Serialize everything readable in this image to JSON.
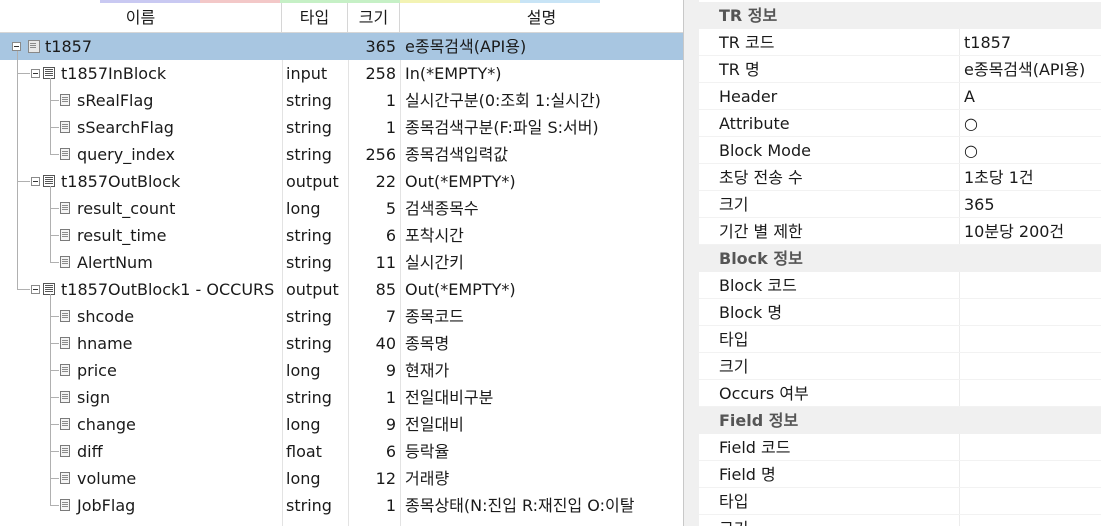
{
  "tree": {
    "columns": {
      "name": "이름",
      "type": "타입",
      "size": "크기",
      "desc": "설명"
    },
    "rows": [
      {
        "name": "t1857",
        "type": "",
        "size": "365",
        "desc": "e종목검색(API용)"
      },
      {
        "name": "t1857InBlock",
        "type": "input",
        "size": "258",
        "desc": "In(*EMPTY*)"
      },
      {
        "name": "sRealFlag",
        "type": "string",
        "size": "1",
        "desc": "실시간구분(0:조회 1:실시간)"
      },
      {
        "name": "sSearchFlag",
        "type": "string",
        "size": "1",
        "desc": "종목검색구분(F:파일 S:서버)"
      },
      {
        "name": "query_index",
        "type": "string",
        "size": "256",
        "desc": "종목검색입력값"
      },
      {
        "name": "t1857OutBlock",
        "type": "output",
        "size": "22",
        "desc": "Out(*EMPTY*)"
      },
      {
        "name": "result_count",
        "type": "long",
        "size": "5",
        "desc": "검색종목수"
      },
      {
        "name": "result_time",
        "type": "string",
        "size": "6",
        "desc": "포착시간"
      },
      {
        "name": "AlertNum",
        "type": "string",
        "size": "11",
        "desc": "실시간키"
      },
      {
        "name": "t1857OutBlock1 - OCCURS",
        "type": "output",
        "size": "85",
        "desc": "Out(*EMPTY*)"
      },
      {
        "name": "shcode",
        "type": "string",
        "size": "7",
        "desc": "종목코드"
      },
      {
        "name": "hname",
        "type": "string",
        "size": "40",
        "desc": "종목명"
      },
      {
        "name": "price",
        "type": "long",
        "size": "9",
        "desc": "현재가"
      },
      {
        "name": "sign",
        "type": "string",
        "size": "1",
        "desc": "전일대비구분"
      },
      {
        "name": "change",
        "type": "long",
        "size": "9",
        "desc": "전일대비"
      },
      {
        "name": "diff",
        "type": "float",
        "size": "6",
        "desc": "등락율"
      },
      {
        "name": "volume",
        "type": "long",
        "size": "12",
        "desc": "거래량"
      },
      {
        "name": "JobFlag",
        "type": "string",
        "size": "1",
        "desc": "종목상태(N:진입 R:재진입 O:이탈"
      }
    ]
  },
  "props": {
    "rows": [
      {
        "label": "TR 정보",
        "value": "",
        "section": true
      },
      {
        "label": "TR 코드",
        "value": "t1857"
      },
      {
        "label": "TR 명",
        "value": "e종목검색(API용)"
      },
      {
        "label": "Header",
        "value": "A"
      },
      {
        "label": "Attribute",
        "value": "○"
      },
      {
        "label": "Block Mode",
        "value": "○"
      },
      {
        "label": "초당 전송 수",
        "value": "1초당 1건"
      },
      {
        "label": "크기",
        "value": "365"
      },
      {
        "label": "기간 별 제한",
        "value": "10분당 200건"
      },
      {
        "label": "Block 정보",
        "value": "",
        "section": true
      },
      {
        "label": "Block 코드",
        "value": ""
      },
      {
        "label": "Block 명",
        "value": ""
      },
      {
        "label": "타입",
        "value": ""
      },
      {
        "label": "크기",
        "value": ""
      },
      {
        "label": "Occurs 여부",
        "value": ""
      },
      {
        "label": "Field 정보",
        "value": "",
        "section": true
      },
      {
        "label": "Field 코드",
        "value": ""
      },
      {
        "label": "Field 명",
        "value": ""
      },
      {
        "label": "타입",
        "value": ""
      },
      {
        "label": "크기",
        "value": ""
      }
    ]
  },
  "colors": {
    "selection": "#a8c6e1",
    "section_bg": "#f0f0f0",
    "tab_strip": [
      "#c9c9f2",
      "#f3c8c8",
      "#c6f0c6",
      "#f3f3b4",
      "#c8e4f6"
    ]
  }
}
